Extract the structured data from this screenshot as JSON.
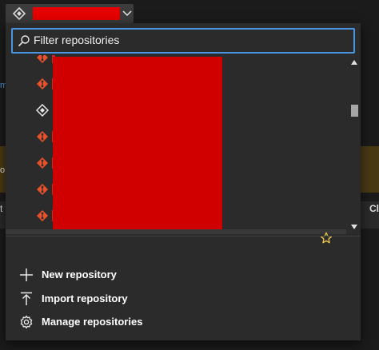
{
  "repo_selector": {
    "current_repo": "",
    "icon": "repo-icon",
    "chevron": "chevron-down-icon"
  },
  "filter": {
    "placeholder": "Filter repositories",
    "value": ""
  },
  "repositories": [
    {
      "icon": "git-icon",
      "name": "",
      "selected": false
    },
    {
      "icon": "git-icon",
      "name": "",
      "selected": false
    },
    {
      "icon": "devops-repo-icon",
      "name": "",
      "selected": false
    },
    {
      "icon": "git-icon",
      "name": "",
      "selected": false
    },
    {
      "icon": "git-icon",
      "name": "",
      "selected": false
    },
    {
      "icon": "git-icon",
      "name": "",
      "selected": false
    },
    {
      "icon": "git-icon",
      "name": "",
      "selected": false
    },
    {
      "icon": "git-icon",
      "name": "",
      "selected": true,
      "favorite": true
    }
  ],
  "actions": [
    {
      "icon": "plus-icon",
      "label": "New repository"
    },
    {
      "icon": "import-icon",
      "label": "Import repository"
    },
    {
      "icon": "gear-icon",
      "label": "Manage repositories"
    }
  ],
  "background": {
    "left_fragment": "m",
    "banner_fragment": "o",
    "row_fragment_left": "t",
    "row_fragment_right": "Cl"
  },
  "colors": {
    "accent": "#4a95e2",
    "git_orange": "#e8512b",
    "redaction": "#d10000",
    "star": "#f2c94c",
    "banner": "#4a3a14"
  }
}
